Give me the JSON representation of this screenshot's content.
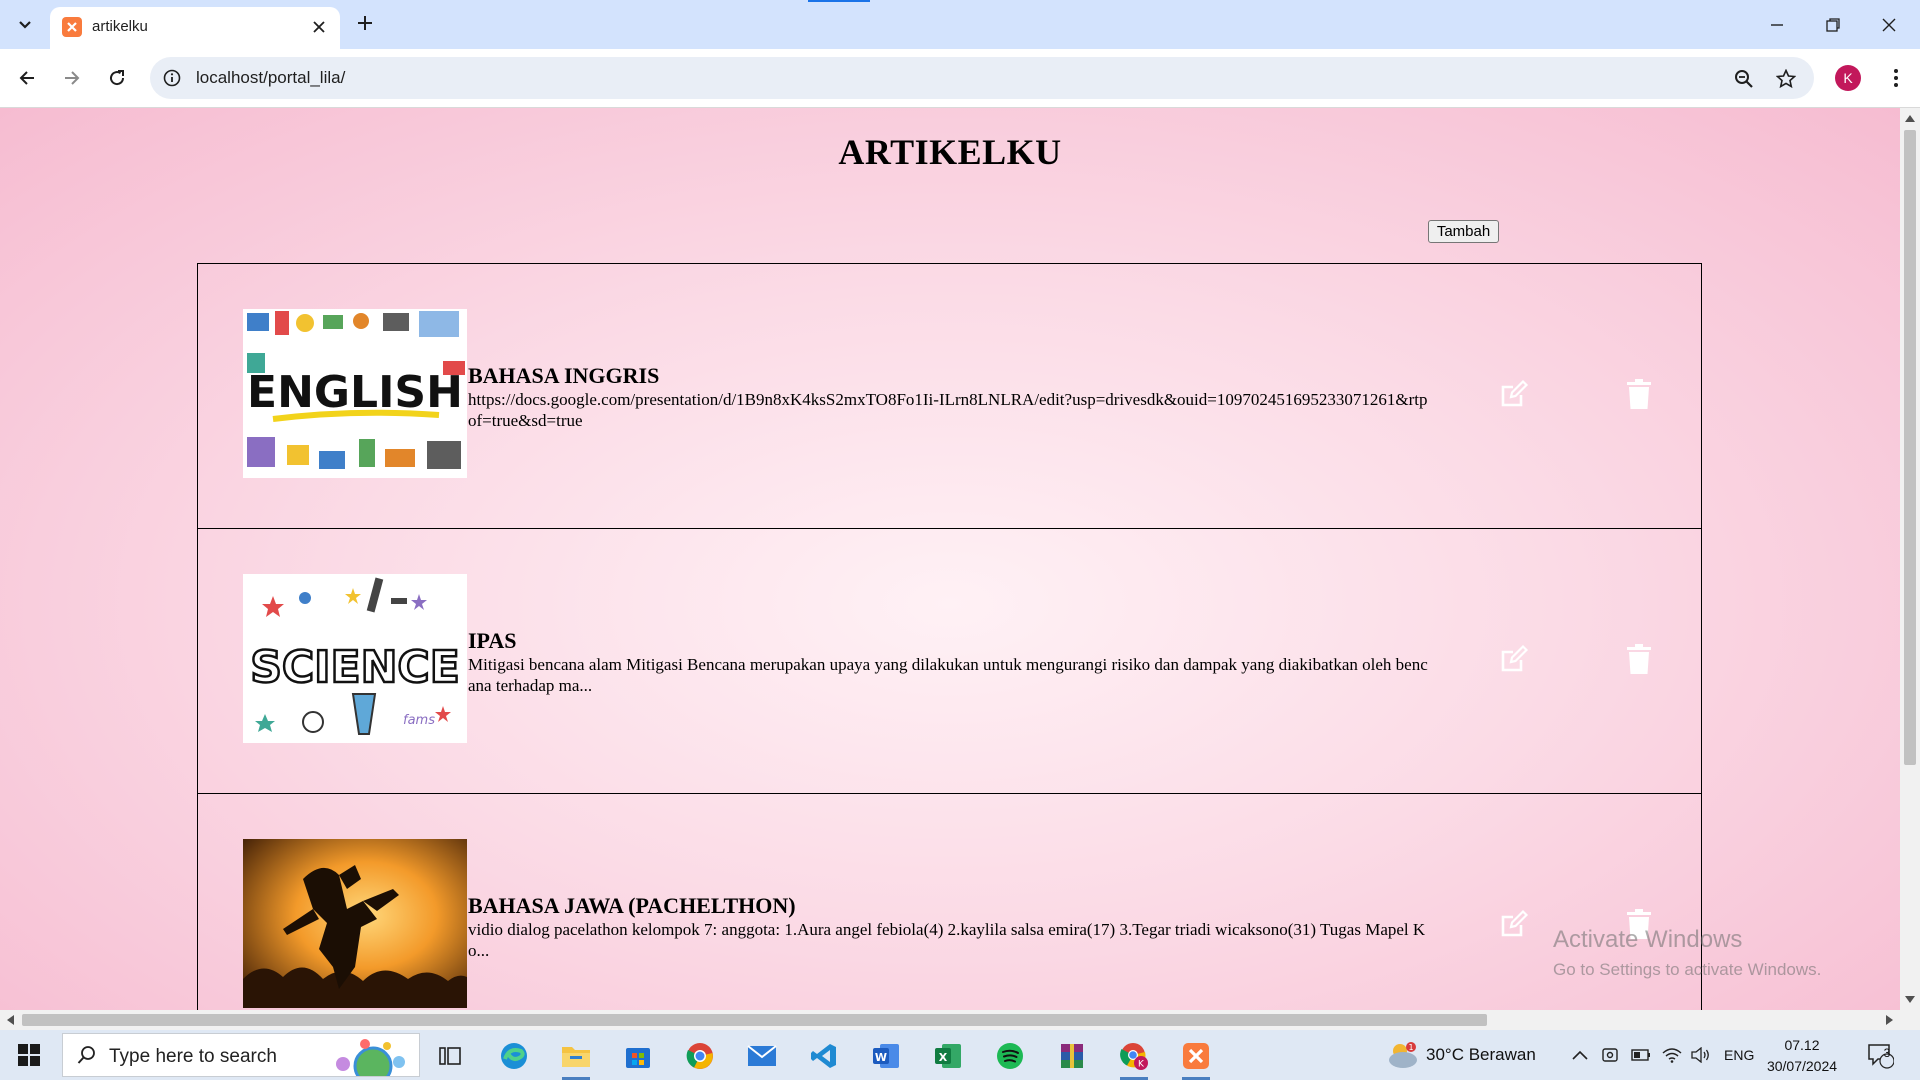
{
  "browser": {
    "tab_title": "artikelku",
    "url": "localhost/portal_lila/",
    "profile_initial": "K"
  },
  "page": {
    "title": "ARTIKELKU",
    "add_button": "Tambah",
    "articles": [
      {
        "title": "BAHASA INGGRIS",
        "description": "https://docs.google.com/presentation/d/1B9n8xK4ksS2mxTO8Fo1Ii-ILrn8LNLRA/edit?usp=drivesdk&ouid=109702451695233071261&rtpof=true&sd=true",
        "image_text": "ENGLISH"
      },
      {
        "title": "IPAS",
        "description": "Mitigasi bencana alam Mitigasi Bencana merupakan upaya yang dilakukan untuk mengurangi risiko dan dampak yang diakibatkan oleh bencana terhadap ma...",
        "image_text": "SCIENCE"
      },
      {
        "title": "BAHASA JAWA (PACHELTHON)",
        "description": "vidio dialog pacelathon kelompok 7: anggota: 1.Aura angel febiola(4) 2.kaylila salsa emira(17) 3.Tegar triadi wicaksono(31) Tugas Mapel Ko...",
        "image_text": ""
      }
    ]
  },
  "watermark": {
    "line1": "Activate Windows",
    "line2": "Go to Settings to activate Windows."
  },
  "taskbar": {
    "search_placeholder": "Type here to search",
    "weather": "30°C  Berawan",
    "language": "ENG",
    "time": "07.12",
    "date": "30/07/2024",
    "notification_count": "3"
  },
  "colors": {
    "page_bg_center": "#fff1f5",
    "page_bg_edge": "#f6bcd1",
    "tab_strip": "#d3e3fd",
    "profile": "#c2185b"
  }
}
